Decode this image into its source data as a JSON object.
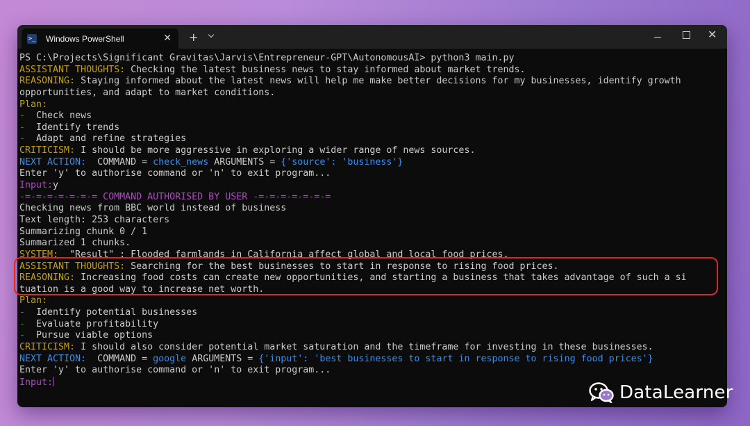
{
  "window": {
    "tab_title": "Windows PowerShell",
    "new_tab": "+",
    "close_glyph": "✕"
  },
  "terminal": {
    "lines": [
      {
        "parts": [
          {
            "t": "PS C:\\Projects\\Significant Gravitas\\Jarvis\\Entrepreneur-GPT\\AutonomousAI> ",
            "c": "white"
          },
          {
            "t": "python3 main.py",
            "c": "white"
          }
        ]
      },
      {
        "parts": [
          {
            "t": "ASSISTANT THOUGHTS:",
            "c": "yellow"
          },
          {
            "t": " Checking the latest business news to stay informed about market trends.",
            "c": "white"
          }
        ]
      },
      {
        "parts": [
          {
            "t": "REASONING:",
            "c": "yellow"
          },
          {
            "t": " Staying informed about the latest news will help me make better decisions for my businesses, identify growth",
            "c": "white"
          }
        ]
      },
      {
        "parts": [
          {
            "t": "opportunities, and adapt to market conditions.",
            "c": "white"
          }
        ]
      },
      {
        "parts": [
          {
            "t": "Plan:",
            "c": "yellow"
          }
        ]
      },
      {
        "parts": [
          {
            "t": "-  ",
            "c": "green"
          },
          {
            "t": "Check news",
            "c": "white"
          }
        ]
      },
      {
        "parts": [
          {
            "t": "-  ",
            "c": "green"
          },
          {
            "t": "Identify trends",
            "c": "white"
          }
        ]
      },
      {
        "parts": [
          {
            "t": "-  ",
            "c": "green"
          },
          {
            "t": "Adapt and refine strategies",
            "c": "white"
          }
        ]
      },
      {
        "parts": [
          {
            "t": "CRITICISM:",
            "c": "yellow"
          },
          {
            "t": " I should be more aggressive in exploring a wider range of news sources.",
            "c": "white"
          }
        ]
      },
      {
        "parts": [
          {
            "t": "NEXT ACTION: ",
            "c": "blue"
          },
          {
            "t": " COMMAND = ",
            "c": "white"
          },
          {
            "t": "check_news",
            "c": "blue"
          },
          {
            "t": " ARGUMENTS = ",
            "c": "white"
          },
          {
            "t": "{'source': 'business'}",
            "c": "blue"
          }
        ]
      },
      {
        "parts": [
          {
            "t": "Enter 'y' to authorise command or 'n' to exit program...",
            "c": "white"
          }
        ]
      },
      {
        "parts": [
          {
            "t": "Input:",
            "c": "purple"
          },
          {
            "t": "y",
            "c": "white"
          }
        ]
      },
      {
        "parts": [
          {
            "t": "-=-=-=-=-=-=-= COMMAND AUTHORISED BY USER -=-=-=-=-=-=-=",
            "c": "purple"
          }
        ]
      },
      {
        "parts": [
          {
            "t": "Checking news from BBC world instead of business",
            "c": "white"
          }
        ]
      },
      {
        "parts": [
          {
            "t": "Text length: 253 characters",
            "c": "white"
          }
        ]
      },
      {
        "parts": [
          {
            "t": "Summarizing chunk 0 / 1",
            "c": "white"
          }
        ]
      },
      {
        "parts": [
          {
            "t": "Summarized 1 chunks.",
            "c": "white"
          }
        ]
      },
      {
        "parts": [
          {
            "t": "SYSTEM: ",
            "c": "yellow"
          },
          {
            "t": " \"Result\" : Flooded farmlands in California affect global and local food prices.",
            "c": "white"
          }
        ]
      },
      {
        "parts": [
          {
            "t": "ASSISTANT THOUGHTS:",
            "c": "yellow"
          },
          {
            "t": " Searching for the best businesses to start in response to rising food prices.",
            "c": "white"
          }
        ]
      },
      {
        "parts": [
          {
            "t": "REASONING:",
            "c": "yellow"
          },
          {
            "t": " Increasing food costs can create new opportunities, and starting a business that takes advantage of such a si",
            "c": "white"
          }
        ]
      },
      {
        "parts": [
          {
            "t": "tuation is a good way to increase net worth.",
            "c": "white"
          }
        ]
      },
      {
        "parts": [
          {
            "t": "Plan:",
            "c": "yellow"
          }
        ]
      },
      {
        "parts": [
          {
            "t": "-  ",
            "c": "green"
          },
          {
            "t": "Identify potential businesses",
            "c": "white"
          }
        ]
      },
      {
        "parts": [
          {
            "t": "-  ",
            "c": "green"
          },
          {
            "t": "Evaluate profitability",
            "c": "white"
          }
        ]
      },
      {
        "parts": [
          {
            "t": "-  ",
            "c": "green"
          },
          {
            "t": "Pursue viable options",
            "c": "white"
          }
        ]
      },
      {
        "parts": [
          {
            "t": "CRITICISM:",
            "c": "yellow"
          },
          {
            "t": " I should also consider potential market saturation and the timeframe for investing in these businesses.",
            "c": "white"
          }
        ]
      },
      {
        "parts": [
          {
            "t": "NEXT ACTION: ",
            "c": "blue"
          },
          {
            "t": " COMMAND = ",
            "c": "white"
          },
          {
            "t": "google",
            "c": "blue"
          },
          {
            "t": " ARGUMENTS = ",
            "c": "white"
          },
          {
            "t": "{'input': 'best businesses to start in response to rising food prices'}",
            "c": "blue"
          }
        ]
      },
      {
        "parts": [
          {
            "t": "Enter 'y' to authorise command or 'n' to exit program...",
            "c": "white"
          }
        ]
      },
      {
        "parts": [
          {
            "t": "Input:",
            "c": "purple"
          }
        ]
      }
    ]
  },
  "watermark": {
    "text": "DataLearner"
  },
  "colors": {
    "yellow": "#c4a000",
    "green": "#13a10e",
    "blue": "#3b8eea",
    "purple": "#b148c6",
    "highlight": "#e0281f"
  }
}
